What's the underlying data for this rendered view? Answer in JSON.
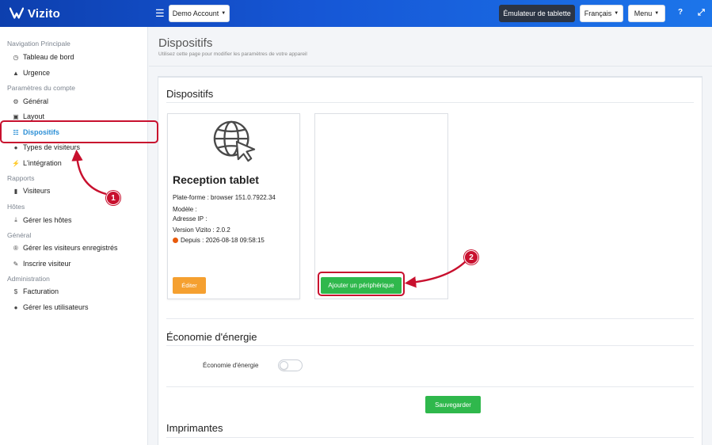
{
  "topbar": {
    "logo_text": "Vizito",
    "account_button": "Demo Account",
    "emulator_button": "Émulateur de tablette",
    "language_button": "Français",
    "menu_button": "Menu",
    "help_icon": "question-icon",
    "fullscreen_icon": "expand-icon"
  },
  "sidebar": {
    "sections": {
      "nav": "Navigation Principale",
      "account": "Paramètres du compte",
      "reports": "Rapports",
      "hosts": "Hôtes",
      "general": "Général",
      "admin": "Administration"
    },
    "items": {
      "dashboard": "Tableau de bord",
      "emergency": "Urgence",
      "general": "Général",
      "layout": "Layout",
      "devices": "Dispositifs",
      "visitor_types": "Types de visiteurs",
      "integration": "L'intégration",
      "visitors": "Visiteurs",
      "manage_hosts": "Gérer les hôtes",
      "manage_registered": "Gérer les visiteurs enregistrés",
      "register_visitor": "Inscrire visiteur",
      "billing": "Facturation",
      "manage_users": "Gérer les utilisateurs"
    }
  },
  "page": {
    "title": "Dispositifs",
    "subtitle": "Utilisez cette page pour modifier les paramètres de votre appareil"
  },
  "devices_section": {
    "title": "Dispositifs",
    "device": {
      "name": "Reception tablet",
      "platform": "Plate-forme : browser 151.0.7922.34",
      "model": "Modèle :",
      "ip": "Adresse IP :",
      "version": "Version Vizito : 2.0.2",
      "since": "Depuis : 2026-08-18 09:58:15",
      "status_color": "#e85a0c",
      "edit_button": "Éditer"
    },
    "add_button": "Ajouter un périphérique"
  },
  "energy_section": {
    "title": "Économie d'énergie",
    "label": "Économie d'énergie",
    "enabled": false,
    "save_button": "Sauvegarder"
  },
  "printers_section": {
    "title": "Imprimantes"
  },
  "annotations": {
    "badge_1": "1",
    "badge_2": "2",
    "color": "#c8102e"
  }
}
